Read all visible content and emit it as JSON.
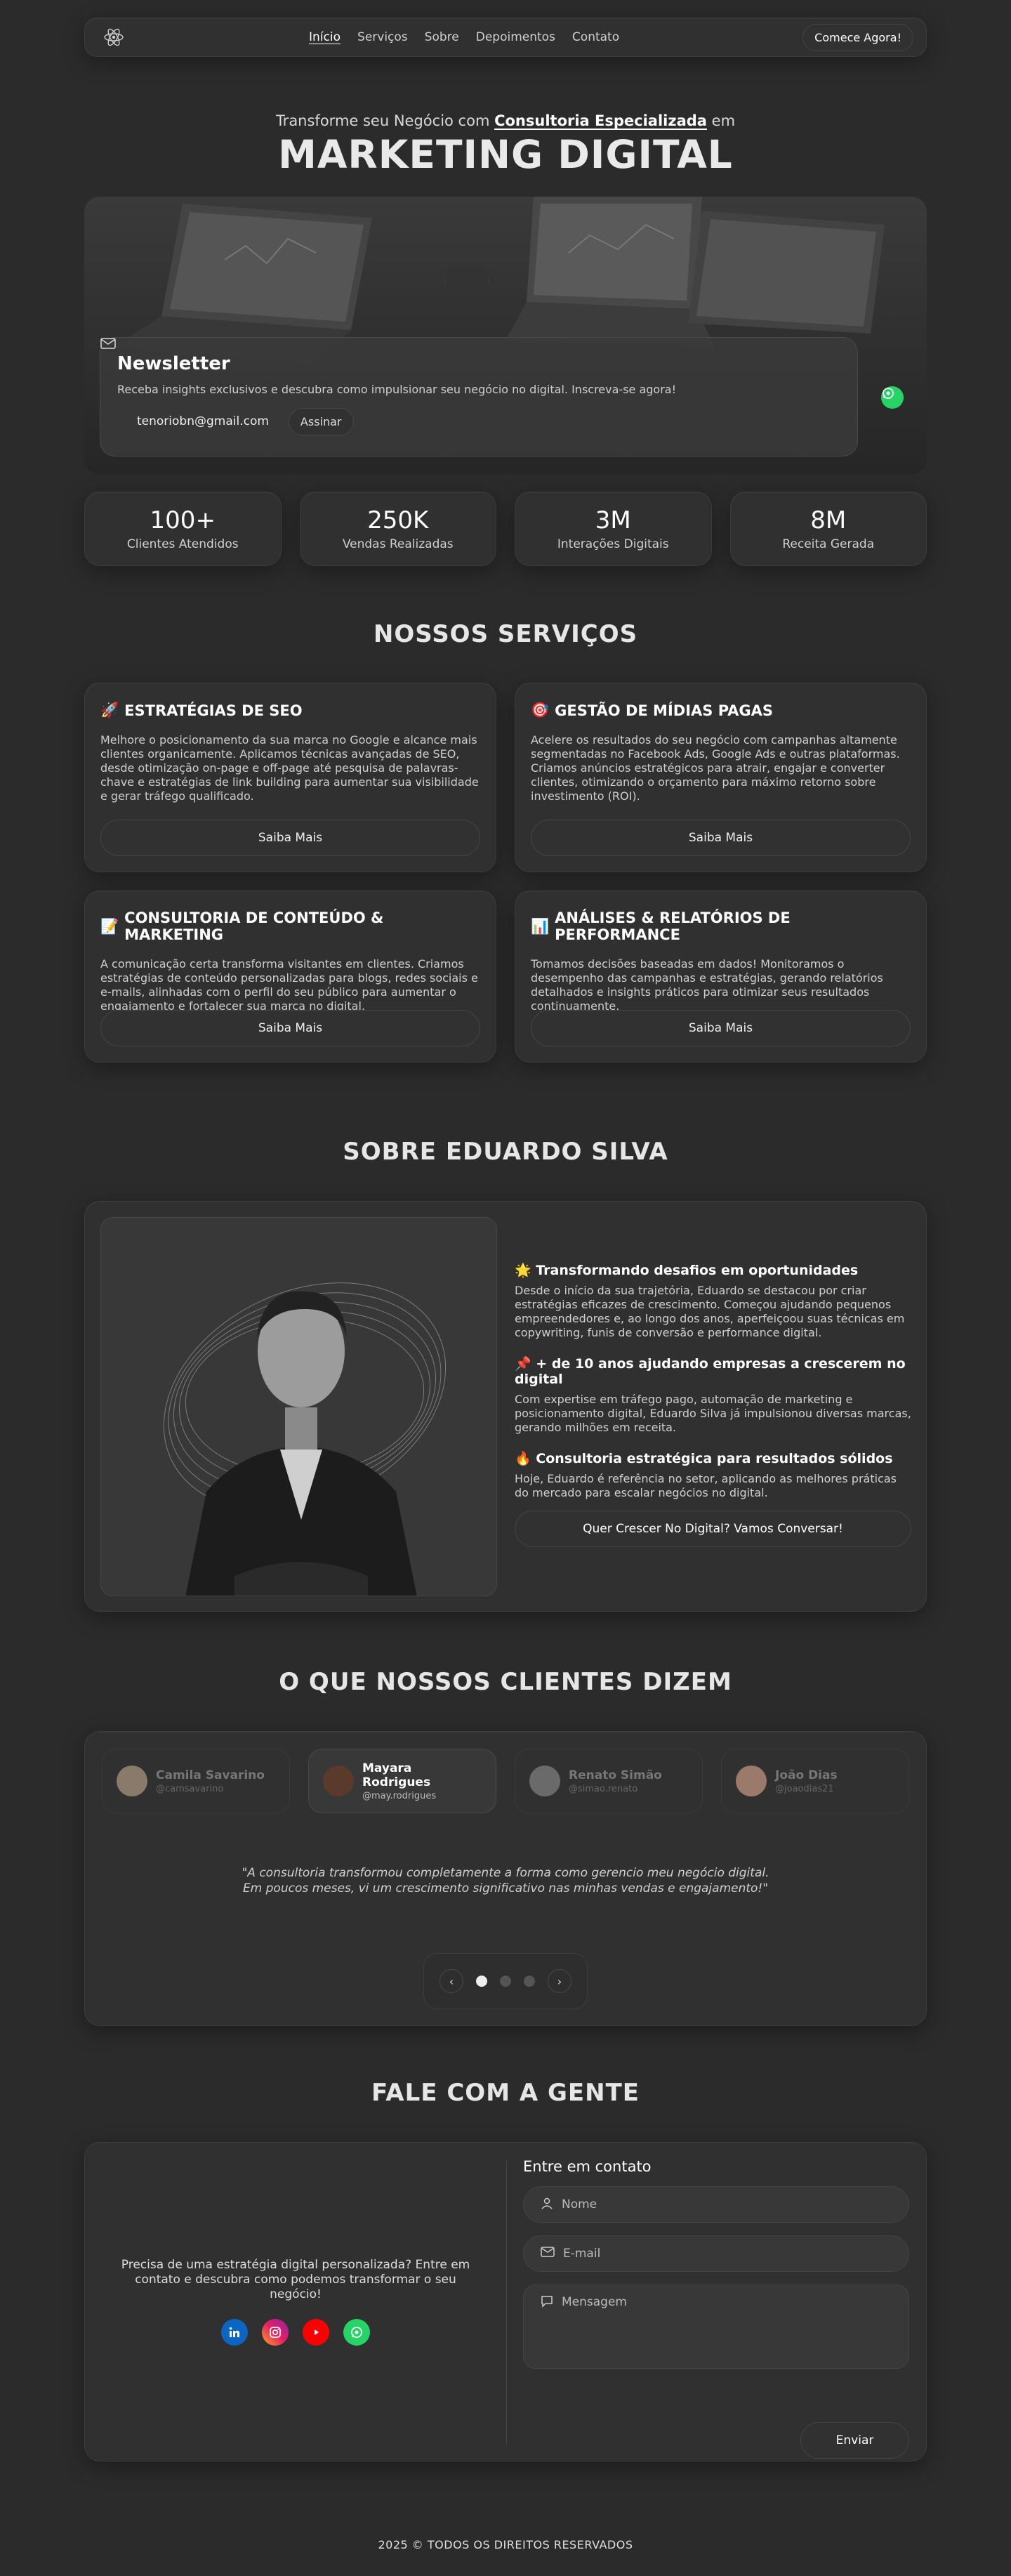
{
  "nav": {
    "logo_icon": "atom-logo-icon",
    "links": [
      "Início",
      "Serviços",
      "Sobre",
      "Depoimentos",
      "Contato"
    ],
    "active": "Início",
    "cta": "Comece Agora!"
  },
  "hero": {
    "subtitle_prefix": "Transforme seu Negócio com",
    "subtitle_highlight": "Consultoria Especializada",
    "subtitle_suffix": "em",
    "title": "MARKETING DIGITAL"
  },
  "newsletter": {
    "title": "Newsletter",
    "description": "Receba insights exclusivos e descubra como impulsionar seu negócio no digital. Inscreva-se agora!",
    "email": "tenoriobn@gmail.com",
    "button": "Assinar"
  },
  "stats": [
    {
      "value": "100+",
      "label": "Clientes Atendidos"
    },
    {
      "value": "250K",
      "label": "Vendas Realizadas"
    },
    {
      "value": "3M",
      "label": "Interações Digitais"
    },
    {
      "value": "8M",
      "label": "Receita Gerada"
    }
  ],
  "services": {
    "title": "NOSSOS SERVIÇOS",
    "items": [
      {
        "icon": "🚀",
        "title": "ESTRATÉGIAS DE SEO",
        "text": "Melhore o posicionamento da sua marca no Google e alcance mais clientes organicamente. Aplicamos técnicas avançadas de SEO, desde otimização on-page e off-page até pesquisa de palavras-chave e estratégias de link building para aumentar sua visibilidade e gerar tráfego qualificado.",
        "button": "Saiba Mais"
      },
      {
        "icon": "🎯",
        "title": "GESTÃO DE MÍDIAS PAGAS",
        "text": "Acelere os resultados do seu negócio com campanhas altamente segmentadas no Facebook Ads, Google Ads e outras plataformas. Criamos anúncios estratégicos para atrair, engajar e converter clientes, otimizando o orçamento para máximo retorno sobre investimento (ROI).",
        "button": "Saiba Mais"
      },
      {
        "icon": "📝",
        "title": "CONSULTORIA DE CONTEÚDO & MARKETING",
        "text": "A comunicação certa transforma visitantes em clientes. Criamos estratégias de conteúdo personalizadas para blogs, redes sociais e e-mails, alinhadas com o perfil do seu público para aumentar o engajamento e fortalecer sua marca no digital.",
        "button": "Saiba Mais"
      },
      {
        "icon": "📊",
        "title": "ANÁLISES & RELATÓRIOS DE PERFORMANCE",
        "text": "Tomamos decisões baseadas em dados! Monitoramos o desempenho das campanhas e estratégias, gerando relatórios detalhados e insights práticos para otimizar seus resultados continuamente.",
        "button": "Saiba Mais"
      }
    ]
  },
  "about": {
    "title": "SOBRE EDUARDO SILVA",
    "blocks": [
      {
        "icon": "🌟",
        "heading": "Transformando desafios em oportunidades",
        "text": "Desde o início da sua trajetória, Eduardo se destacou por criar estratégias eficazes de crescimento. Começou ajudando pequenos empreendedores e, ao longo dos anos, aperfeiçoou suas técnicas em copywriting, funis de conversão e performance digital."
      },
      {
        "icon": "📌",
        "heading": "+ de 10 anos ajudando empresas a crescerem no digital",
        "text": "Com expertise em tráfego pago, automação de marketing e posicionamento digital, Eduardo Silva já impulsionou diversas marcas, gerando milhões em receita."
      },
      {
        "icon": "🔥",
        "heading": "Consultoria estratégica para resultados sólidos",
        "text": "Hoje, Eduardo é referência no setor, aplicando as melhores práticas do mercado para escalar negócios no digital."
      }
    ],
    "button": "Quer Crescer No Digital? Vamos Conversar!"
  },
  "testimonials": {
    "title": "O QUE NOSSOS CLIENTES DIZEM",
    "people": [
      {
        "name": "Camila Savarino",
        "handle": "@camsavarino"
      },
      {
        "name": "Mayara Rodrigues",
        "handle": "@may.rodrigues"
      },
      {
        "name": "Renato Simão",
        "handle": "@simao.renato"
      },
      {
        "name": "João Dias",
        "handle": "@joaodias21"
      }
    ],
    "active_index": 1,
    "quote_line1": "\"A consultoria transformou completamente a forma como gerencio meu negócio digital.",
    "quote_line2": "Em poucos meses, vi um crescimento significativo nas minhas vendas e engajamento!\"",
    "prev": "‹",
    "next": "›"
  },
  "contact": {
    "title": "FALE COM A GENTE",
    "left_text": "Precisa de uma estratégia digital personalizada? Entre em contato e descubra como podemos transformar o seu negócio!",
    "form_title": "Entre em contato",
    "name_placeholder": "Nome",
    "email_placeholder": "E-mail",
    "message_placeholder": "Mensagem",
    "send": "Enviar",
    "socials": [
      "linkedin-icon",
      "instagram-icon",
      "youtube-icon",
      "whatsapp-icon"
    ]
  },
  "footer": {
    "text": "2025 © TODOS OS DIREITOS RESERVADOS"
  },
  "colors": {
    "background": "#2b2b2b",
    "card": "#303030",
    "whatsapp": "#25d366",
    "linkedin": "#0a66c2",
    "youtube": "#ff0000"
  }
}
